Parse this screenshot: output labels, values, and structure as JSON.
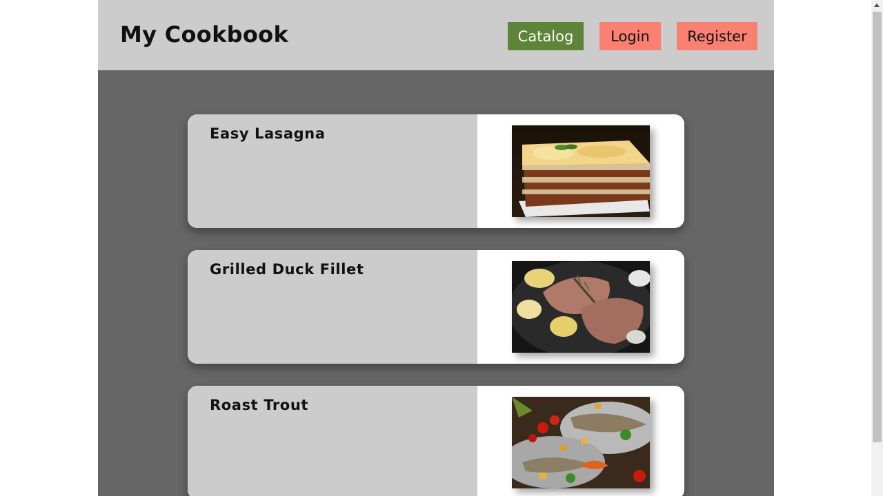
{
  "header": {
    "brand": "My Cookbook",
    "nav": {
      "catalog": "Catalog",
      "login": "Login",
      "register": "Register"
    }
  },
  "recipes": [
    {
      "title": "Easy Lasagna",
      "image": "lasagna-photo"
    },
    {
      "title": "Grilled Duck Fillet",
      "image": "duck-fillet-photo"
    },
    {
      "title": "Roast Trout",
      "image": "roast-trout-photo"
    }
  ],
  "colors": {
    "header_bg": "#cccccc",
    "page_bg": "#666666",
    "catalog_button": "#5e8438",
    "auth_button": "#fa8072"
  }
}
